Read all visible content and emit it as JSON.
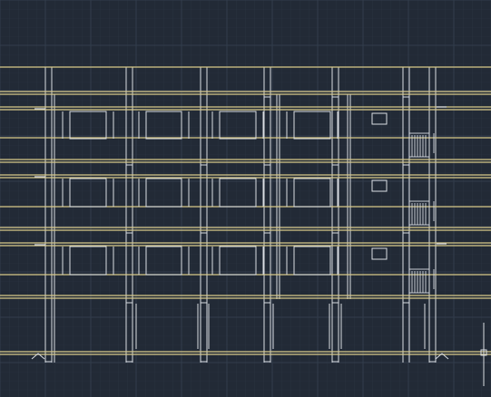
{
  "viewport": {
    "background": "#222a36",
    "grid_minor_color": "#2b3442",
    "grid_major_color": "#323c4c",
    "line_color": "#d9dde3",
    "level_line_color": "#d8c98a",
    "ucs_icon": "ucs-icon"
  },
  "drawing": {
    "type": "building-elevation",
    "storeys": 3,
    "bays": 5,
    "balcony_railings": 3
  }
}
